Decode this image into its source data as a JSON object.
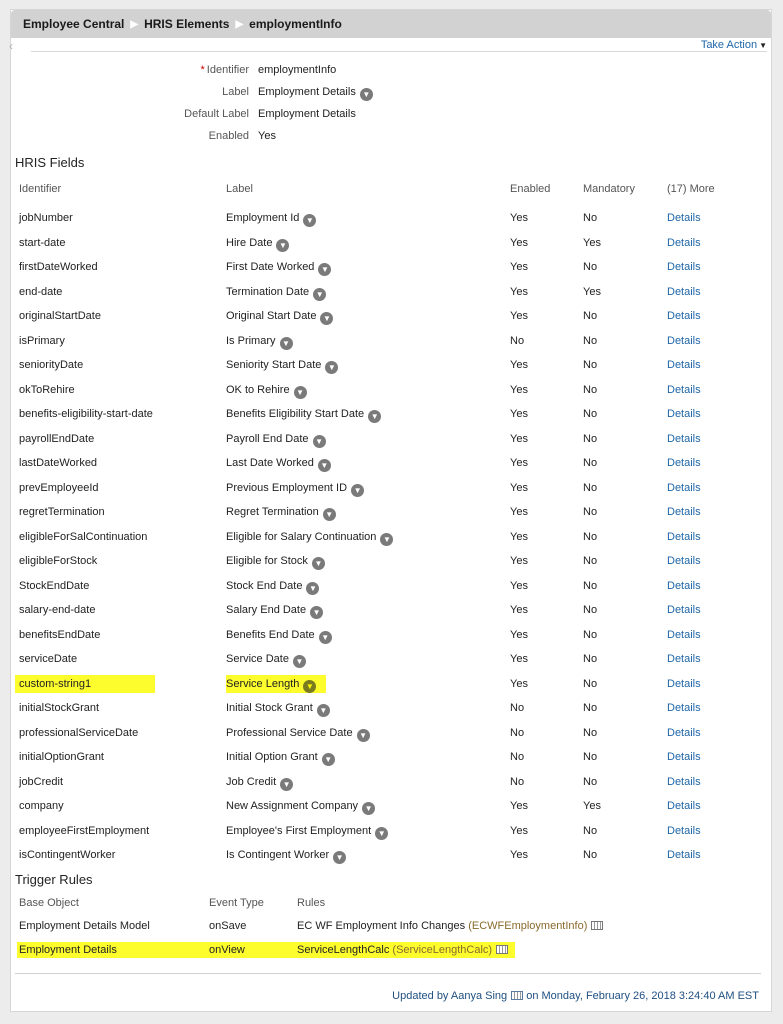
{
  "breadcrumb": [
    "Employee Central",
    "HRIS Elements",
    "employmentInfo"
  ],
  "take_action": "Take Action",
  "properties": [
    {
      "label": "Identifier",
      "value": "employmentInfo",
      "required": true,
      "has_icon": false
    },
    {
      "label": "Label",
      "value": "Employment Details",
      "required": false,
      "has_icon": true
    },
    {
      "label": "Default Label",
      "value": "Employment Details",
      "required": false,
      "has_icon": false
    },
    {
      "label": "Enabled",
      "value": "Yes",
      "required": false,
      "has_icon": false
    }
  ],
  "required_mark": "*",
  "hris_fields": {
    "title": "HRIS Fields",
    "headers": [
      "Identifier",
      "Label",
      "Enabled",
      "Mandatory",
      "(17) More"
    ],
    "details_label": "Details",
    "rows": [
      {
        "id": "jobNumber",
        "label": "Employment Id",
        "enabled": "Yes",
        "mandatory": "No"
      },
      {
        "id": "start-date",
        "label": "Hire Date",
        "enabled": "Yes",
        "mandatory": "Yes"
      },
      {
        "id": "firstDateWorked",
        "label": "First Date Worked",
        "enabled": "Yes",
        "mandatory": "No"
      },
      {
        "id": "end-date",
        "label": "Termination Date",
        "enabled": "Yes",
        "mandatory": "Yes"
      },
      {
        "id": "originalStartDate",
        "label": "Original Start Date",
        "enabled": "Yes",
        "mandatory": "No"
      },
      {
        "id": "isPrimary",
        "label": "Is Primary",
        "enabled": "No",
        "mandatory": "No"
      },
      {
        "id": "seniorityDate",
        "label": "Seniority Start Date",
        "enabled": "Yes",
        "mandatory": "No"
      },
      {
        "id": "okToRehire",
        "label": "OK to Rehire",
        "enabled": "Yes",
        "mandatory": "No"
      },
      {
        "id": "benefits-eligibility-start-date",
        "label": "Benefits Eligibility Start Date",
        "enabled": "Yes",
        "mandatory": "No"
      },
      {
        "id": "payrollEndDate",
        "label": "Payroll End Date",
        "enabled": "Yes",
        "mandatory": "No"
      },
      {
        "id": "lastDateWorked",
        "label": "Last Date Worked",
        "enabled": "Yes",
        "mandatory": "No"
      },
      {
        "id": "prevEmployeeId",
        "label": "Previous Employment ID",
        "enabled": "Yes",
        "mandatory": "No"
      },
      {
        "id": "regretTermination",
        "label": "Regret Termination",
        "enabled": "Yes",
        "mandatory": "No"
      },
      {
        "id": "eligibleForSalContinuation",
        "label": "Eligible for Salary Continuation",
        "enabled": "Yes",
        "mandatory": "No"
      },
      {
        "id": "eligibleForStock",
        "label": "Eligible for Stock",
        "enabled": "Yes",
        "mandatory": "No"
      },
      {
        "id": "StockEndDate",
        "label": "Stock End Date",
        "enabled": "Yes",
        "mandatory": "No"
      },
      {
        "id": "salary-end-date",
        "label": "Salary End Date",
        "enabled": "Yes",
        "mandatory": "No"
      },
      {
        "id": "benefitsEndDate",
        "label": "Benefits End Date",
        "enabled": "Yes",
        "mandatory": "No"
      },
      {
        "id": "serviceDate",
        "label": "Service Date",
        "enabled": "Yes",
        "mandatory": "No"
      },
      {
        "id": "custom-string1",
        "label": "Service Length",
        "enabled": "Yes",
        "mandatory": "No",
        "highlighted": true
      },
      {
        "id": "initialStockGrant",
        "label": "Initial Stock Grant",
        "enabled": "No",
        "mandatory": "No"
      },
      {
        "id": "professionalServiceDate",
        "label": "Professional Service Date",
        "enabled": "No",
        "mandatory": "No"
      },
      {
        "id": "initialOptionGrant",
        "label": "Initial Option Grant",
        "enabled": "No",
        "mandatory": "No"
      },
      {
        "id": "jobCredit",
        "label": "Job Credit",
        "enabled": "No",
        "mandatory": "No"
      },
      {
        "id": "company",
        "label": "New Assignment Company",
        "enabled": "Yes",
        "mandatory": "Yes"
      },
      {
        "id": "employeeFirstEmployment",
        "label": "Employee's First Employment",
        "enabled": "Yes",
        "mandatory": "No"
      },
      {
        "id": "isContingentWorker",
        "label": "Is Contingent Worker",
        "enabled": "Yes",
        "mandatory": "No"
      }
    ]
  },
  "trigger_rules": {
    "title": "Trigger Rules",
    "headers": [
      "Base Object",
      "Event Type",
      "Rules"
    ],
    "rows": [
      {
        "base": "Employment Details Model",
        "event": "onSave",
        "rule": "EC WF Employment Info Changes",
        "code": "(ECWFEmploymentInfo)"
      },
      {
        "base": "Employment Details",
        "event": "onView",
        "rule": "ServiceLengthCalc",
        "code": "(ServiceLengthCalc)",
        "highlighted": true
      }
    ]
  },
  "footer": {
    "prefix": "Updated by Aanya Sing",
    "suffix": "on Monday, February 26, 2018 3:24:40 AM EST"
  },
  "colors": {
    "link": "#1f66a8",
    "highlight": "#fdfd2e",
    "header_bar": "#d2d2d2"
  }
}
